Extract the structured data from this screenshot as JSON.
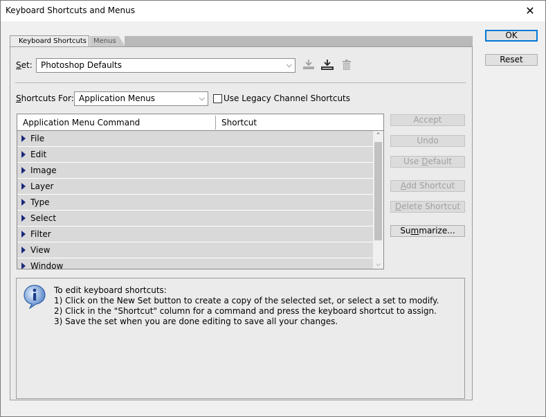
{
  "window": {
    "title": "Keyboard Shortcuts and Menus",
    "close_glyph": "✕"
  },
  "tabs": [
    {
      "label": "Keyboard Shortcuts",
      "active": true
    },
    {
      "label": "Menus",
      "active": false
    }
  ],
  "set": {
    "label_prefix": "",
    "label_ul": "S",
    "label_rest": "et:",
    "value": "Photoshop Defaults",
    "icons": [
      "save-set-icon",
      "new-set-icon",
      "delete-set-icon"
    ]
  },
  "shortcuts_for": {
    "label_ul": "S",
    "label_rest": "hortcuts For:",
    "value": "Application Menus",
    "legacy_checkbox_label": "Use Legacy Channel Shortcuts",
    "legacy_checked": false
  },
  "table": {
    "col1": "Application Menu Command",
    "col2": "Shortcut",
    "rows": [
      "File",
      "Edit",
      "Image",
      "Layer",
      "Type",
      "Select",
      "Filter",
      "View",
      "Window"
    ]
  },
  "side_buttons": {
    "accept": "Accept",
    "undo": "Undo",
    "use_default_pre": "Use ",
    "use_default_ul": "D",
    "use_default_post": "efault",
    "add_shortcut_ul": "A",
    "add_shortcut_post": "dd Shortcut",
    "delete_shortcut_ul": "D",
    "delete_shortcut_post": "elete Shortcut",
    "summarize_pre": "Su",
    "summarize_ul": "m",
    "summarize_post": "marize..."
  },
  "dialog_buttons": {
    "ok": "OK",
    "reset": "Reset"
  },
  "info": {
    "heading": "To edit keyboard shortcuts:",
    "line1": "1) Click on the New Set button to create a copy of the selected set, or select a set to modify.",
    "line2": "2) Click in the \"Shortcut\" column for a command and press the keyboard shortcut to assign.",
    "line3": "3) Save the set when you are done editing to save all your changes."
  },
  "colors": {
    "accent": "#0078d7",
    "row_bg": "#d9d9d9",
    "triangle": "#1b2a7a"
  }
}
